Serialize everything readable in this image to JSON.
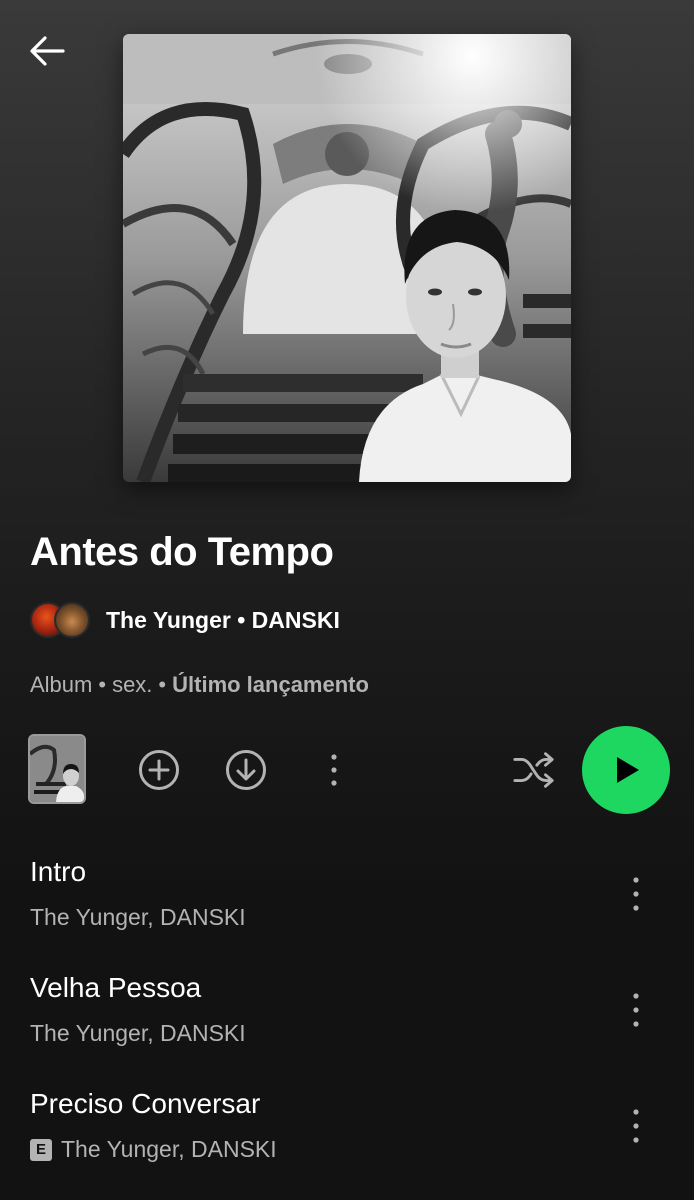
{
  "header": {
    "back_icon": "arrow-left-icon"
  },
  "album": {
    "title": "Antes do Tempo",
    "artists": "The Yunger • DANSKI",
    "type": "Album",
    "day": "sex.",
    "label": "Último lançamento",
    "separator": "•"
  },
  "actions": {
    "add_icon": "plus-circle-icon",
    "download_icon": "download-circle-icon",
    "more_icon": "more-vertical-icon",
    "shuffle_icon": "shuffle-icon",
    "play_icon": "play-icon",
    "play_color": "#1ed760"
  },
  "tracks": [
    {
      "title": "Intro",
      "artists": "The Yunger, DANSKI",
      "explicit": false
    },
    {
      "title": "Velha Pessoa",
      "artists": "The Yunger, DANSKI",
      "explicit": false
    },
    {
      "title": "Preciso Conversar",
      "artists": "The Yunger, DANSKI",
      "explicit": true,
      "explicit_label": "E"
    }
  ],
  "colors": {
    "background_top": "#3a3a3a",
    "background_bottom": "#121212",
    "text_primary": "#ffffff",
    "text_secondary": "#b3b3b3",
    "accent": "#1ed760"
  }
}
